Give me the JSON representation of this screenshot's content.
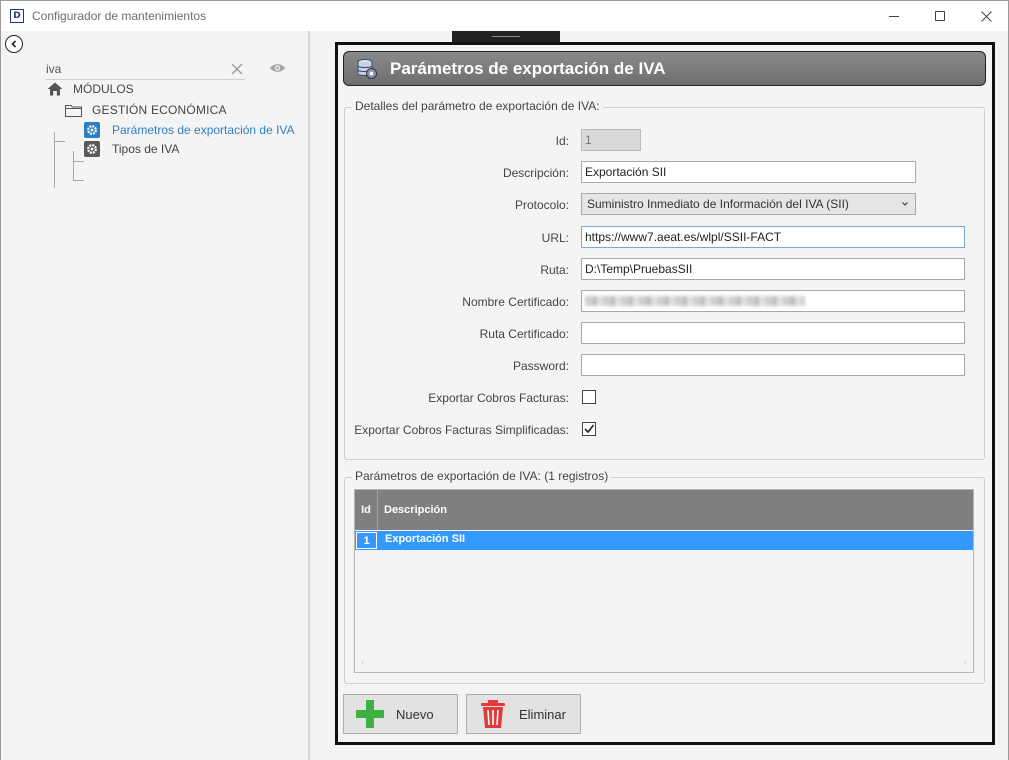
{
  "window": {
    "title": "Configurador de mantenimientos",
    "app_icon": "D"
  },
  "sidebar": {
    "search": {
      "value": "iva",
      "placeholder": ""
    },
    "tree": {
      "root": "MÓDULOS",
      "group": "GESTIÓN ECONÓMICA",
      "items": [
        {
          "label": "Parámetros de exportación de IVA",
          "selected": true
        },
        {
          "label": "Tipos de IVA",
          "selected": false
        }
      ]
    }
  },
  "main": {
    "header_title": "Parámetros de exportación de IVA",
    "details": {
      "legend": "Detalles del parámetro de exportación de IVA:",
      "fields": {
        "id_label": "Id:",
        "id_value": "1",
        "descripcion_label": "Descripción:",
        "descripcion_value": "Exportación SII",
        "protocolo_label": "Protocolo:",
        "protocolo_value": "Suministro Inmediato de Información del IVA (SII)",
        "url_label": "URL:",
        "url_value": "https://www7.aeat.es/wlpl/SSII-FACT",
        "ruta_label": "Ruta:",
        "ruta_value": "D:\\Temp\\PruebasSII",
        "nombre_cert_label": "Nombre Certificado:",
        "ruta_cert_label": "Ruta Certificado:",
        "ruta_cert_value": "",
        "password_label": "Password:",
        "password_value": "",
        "exportar_cobros_label": "Exportar Cobros Facturas:",
        "exportar_cobros_checked": false,
        "exportar_simpl_label": "Exportar Cobros Facturas Simplificadas:",
        "exportar_simpl_checked": true
      }
    },
    "list": {
      "legend": "Parámetros de exportación de IVA:  (1 registros)",
      "columns": [
        "Id",
        "Descripción"
      ],
      "rows": [
        {
          "id": "1",
          "descripcion": "Exportación SII"
        }
      ]
    },
    "buttons": {
      "nuevo": "Nuevo",
      "eliminar": "Eliminar"
    }
  },
  "colors": {
    "accent": "#2f7fc1",
    "selection": "#3399ff",
    "header_gray": "#7f7f7f",
    "add_green": "#3cb043",
    "delete_red": "#e03a3a"
  }
}
